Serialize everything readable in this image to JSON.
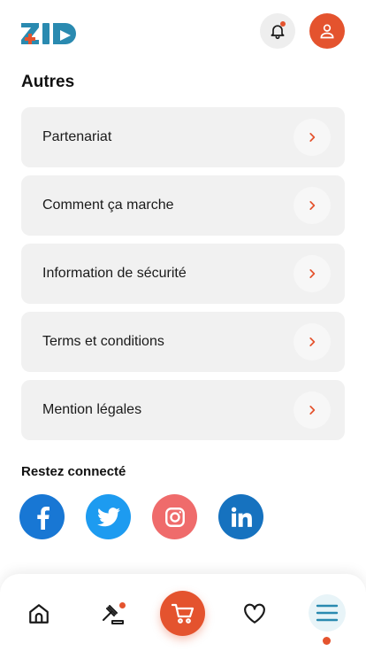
{
  "brand": {
    "name": "ZID",
    "accent_color": "#e4532e",
    "logo_color": "#2a8ab0"
  },
  "header": {
    "notification_icon": "bell-icon",
    "has_unread_notifications": true,
    "profile_icon": "user-icon"
  },
  "section": {
    "title": "Autres"
  },
  "menu_items": [
    {
      "label": "Partenariat"
    },
    {
      "label": "Comment ça marche"
    },
    {
      "label": "Information de sécurité"
    },
    {
      "label": "Terms et conditions"
    },
    {
      "label": "Mention légales"
    }
  ],
  "social": {
    "title": "Restez connecté",
    "networks": [
      "facebook-icon",
      "twitter-icon",
      "instagram-icon",
      "linkedin-icon"
    ]
  },
  "bottom_nav": {
    "items": [
      "home-icon",
      "auction-gavel-icon",
      "cart-icon",
      "heart-icon",
      "hamburger-menu-icon"
    ],
    "active": "hamburger-menu-icon",
    "auction_has_badge": true
  }
}
